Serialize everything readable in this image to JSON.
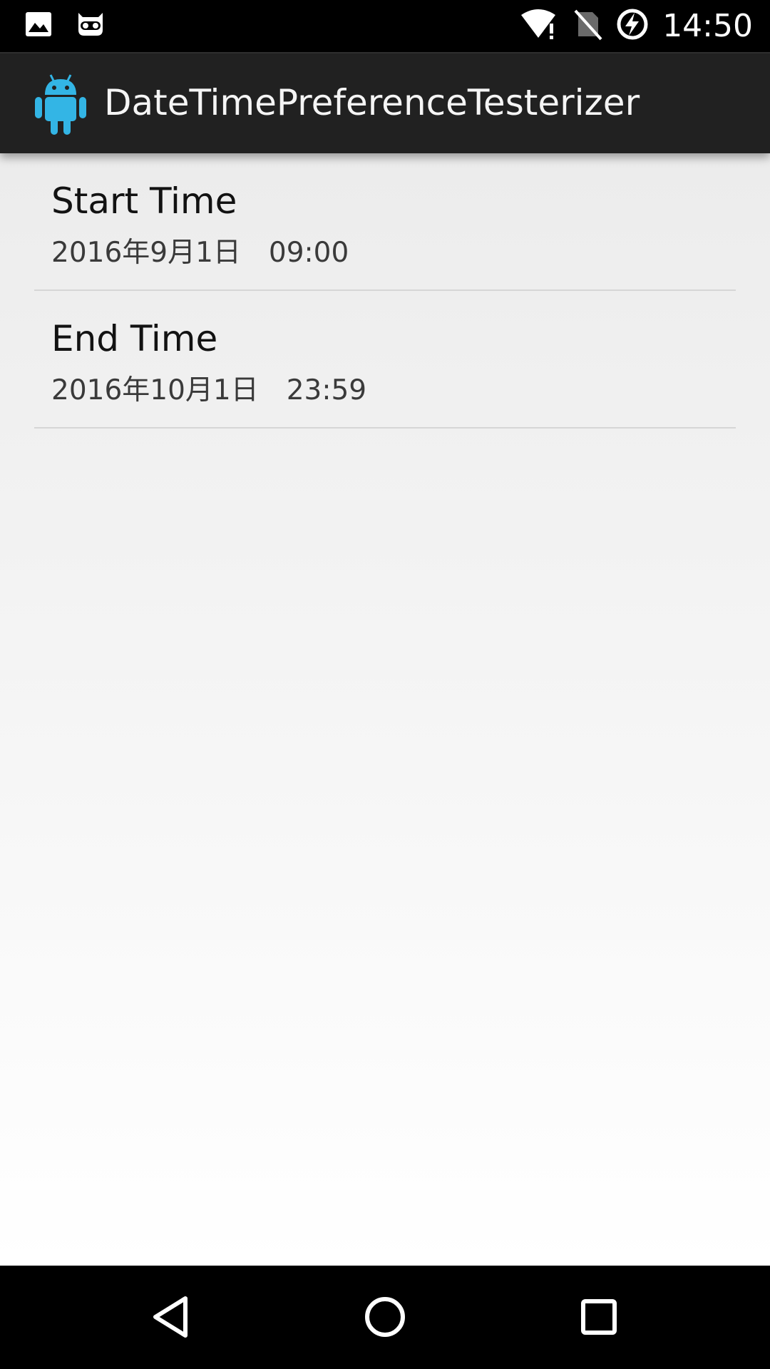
{
  "status_bar": {
    "time": "14:50",
    "left_icons": [
      "image-notification-icon",
      "cyanogenmod-notification-icon"
    ],
    "right_icons": [
      "wifi-alert-icon",
      "no-sim-icon",
      "battery-charging-icon"
    ]
  },
  "action_bar": {
    "app_icon": "android-robot-icon",
    "title": "DateTimePreferenceTesterizer",
    "icon_color": "#33b5e5"
  },
  "preferences": [
    {
      "title": "Start Time",
      "summary": "2016年9月1日　09:00"
    },
    {
      "title": "End Time",
      "summary": "2016年10月1日　23:59"
    }
  ],
  "nav_bar": {
    "buttons": [
      "back-icon",
      "home-icon",
      "recents-icon"
    ]
  }
}
